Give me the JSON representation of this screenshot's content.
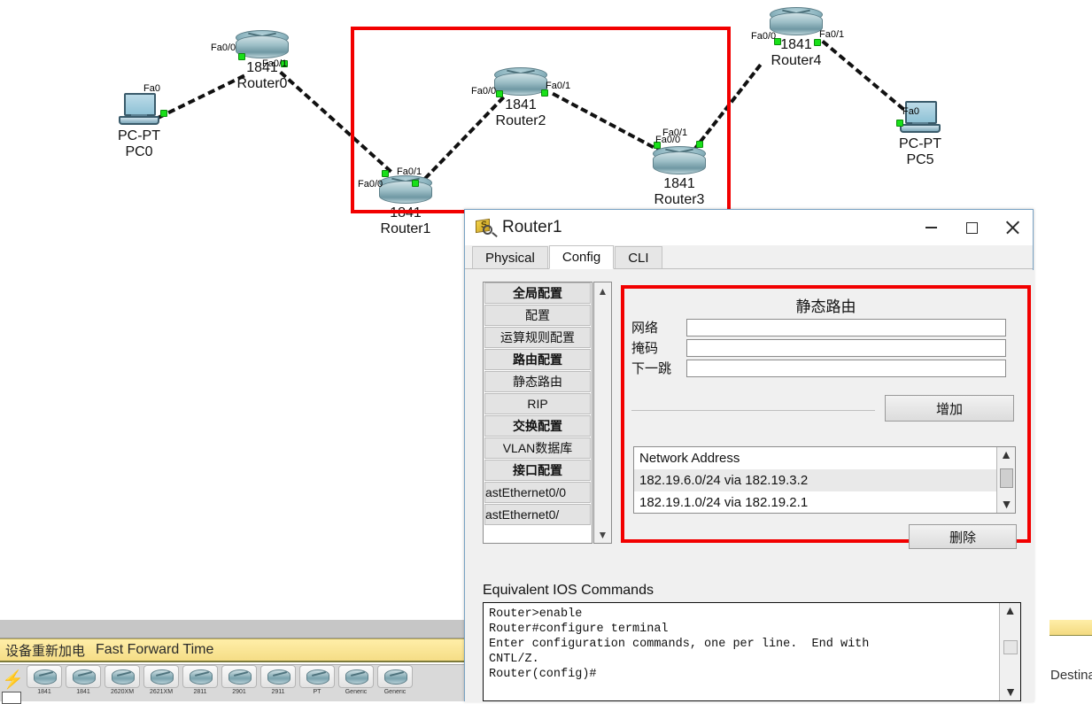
{
  "topology": {
    "devices": [
      {
        "id": "pc0",
        "type": "pc",
        "model": "PC-PT",
        "name": "PC0",
        "ports": [
          "Fa0"
        ]
      },
      {
        "id": "router0",
        "type": "router",
        "model": "1841",
        "name": "Router0",
        "ports": [
          "Fa0/0",
          "Fa0/1"
        ]
      },
      {
        "id": "router1",
        "type": "router",
        "model": "1841",
        "name": "Router1",
        "ports": [
          "Fa0/0",
          "Fa0/1"
        ]
      },
      {
        "id": "router2",
        "type": "router",
        "model": "1841",
        "name": "Router2",
        "ports": [
          "Fa0/0",
          "Fa0/1"
        ]
      },
      {
        "id": "router3",
        "type": "router",
        "model": "1841",
        "name": "Router3",
        "ports": [
          "Fa0/0",
          "Fa0/1"
        ]
      },
      {
        "id": "router4",
        "type": "router",
        "model": "1841",
        "name": "Router4",
        "ports": [
          "Fa0/0",
          "Fa0/1"
        ]
      },
      {
        "id": "pc5",
        "type": "pc",
        "model": "PC-PT",
        "name": "PC5",
        "ports": [
          "Fa0"
        ]
      }
    ],
    "labels": {
      "pc0_model": "PC-PT",
      "pc0_name": "PC0",
      "pc0_fa0": "Fa0",
      "r0_model": "1841",
      "r0_name": "Router0",
      "r0_fa00": "Fa0/0",
      "r0_fa01": "Fa0/1",
      "r1_model": "1841",
      "r1_name": "Router1",
      "r1_fa00": "Fa0/0",
      "r1_fa01": "Fa0/1",
      "r2_model": "1841",
      "r2_name": "Router2",
      "r2_fa00": "Fa0/0",
      "r2_fa01": "Fa0/1",
      "r3_model": "1841",
      "r3_name": "Router3",
      "r3_fa00": "Fa0/0",
      "r3_fa01": "Fa0/1",
      "r4_model": "1841",
      "r4_name": "Router4",
      "r4_fa00": "Fa0/0",
      "r4_fa01": "Fa0/1",
      "pc5_model": "PC-PT",
      "pc5_name": "PC5",
      "pc5_fa0": "Fa0"
    },
    "highlight_color": "#f20000"
  },
  "bottom_bar": {
    "tooltip_cn": "设备重新加电",
    "tooltip_en": "Fast Forward Time",
    "palette_items": [
      {
        "label": "1841"
      },
      {
        "label": "1841"
      },
      {
        "label": "2620XM"
      },
      {
        "label": "2621XM"
      },
      {
        "label": "2811"
      },
      {
        "label": "2901"
      },
      {
        "label": "2911"
      },
      {
        "label": "PT"
      },
      {
        "label": "Generic"
      },
      {
        "label": "Generic"
      }
    ],
    "right_column_header": "Destina"
  },
  "dialog": {
    "title": "Router1",
    "window_buttons": {
      "minimize": "minimize-icon",
      "maximize": "maximize-icon",
      "close": "close-icon"
    },
    "tabs": [
      {
        "label": "Physical",
        "active": false
      },
      {
        "label": "Config",
        "active": true
      },
      {
        "label": "CLI",
        "active": false
      }
    ],
    "tree": [
      {
        "label": "全局配置",
        "type": "header"
      },
      {
        "label": "配置",
        "type": "item"
      },
      {
        "label": "运算规则配置",
        "type": "item"
      },
      {
        "label": "路由配置",
        "type": "header"
      },
      {
        "label": "静态路由",
        "type": "item"
      },
      {
        "label": "RIP",
        "type": "item"
      },
      {
        "label": "交换配置",
        "type": "header"
      },
      {
        "label": "VLAN数据库",
        "type": "item"
      },
      {
        "label": "接口配置",
        "type": "header"
      },
      {
        "label": "astEthernet0/0",
        "type": "interface"
      },
      {
        "label": "astEthernet0/",
        "type": "interface"
      }
    ],
    "tree_scroll": {
      "up": "▲",
      "down": "▼"
    },
    "static_route": {
      "title": "静态路由",
      "network_label": "网络",
      "network_value": "",
      "mask_label": "掩码",
      "mask_value": "",
      "next_hop_label": "下一跳",
      "next_hop_value": "",
      "add_button": "增加",
      "remove_button": "删除",
      "list_header": "Network Address",
      "routes": [
        "182.19.6.0/24 via 182.19.3.2",
        "182.19.1.0/24 via 182.19.2.1"
      ],
      "highlight_color": "#f20000"
    },
    "ios": {
      "label": "Equivalent IOS Commands",
      "text": "Router>enable\nRouter#configure terminal\nEnter configuration commands, one per line.  End with\nCNTL/Z.\nRouter(config)#"
    }
  }
}
